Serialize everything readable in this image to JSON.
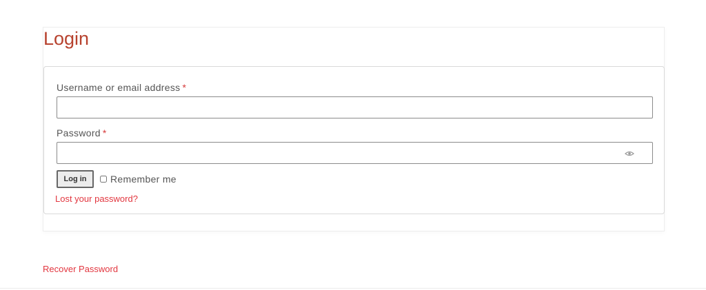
{
  "login": {
    "title": "Login",
    "username": {
      "label": "Username or email address",
      "required_mark": "*",
      "value": "",
      "placeholder": ""
    },
    "password": {
      "label": "Password",
      "required_mark": "*",
      "value": "",
      "placeholder": "",
      "toggle_icon": "eye-icon"
    },
    "submit_label": "Log in",
    "remember_label": "Remember me",
    "remember_checked": false,
    "lost_password_label": "Lost your password?"
  },
  "footer": {
    "recover_label": "Recover Password"
  },
  "colors": {
    "title": "#b7422e",
    "link": "#e2363f",
    "required": "#d63a3a",
    "text": "#555555"
  }
}
